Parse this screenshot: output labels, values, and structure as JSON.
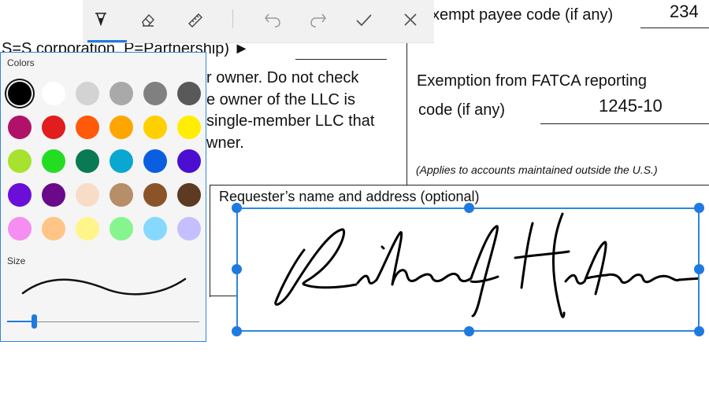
{
  "toolbar": {
    "tools": [
      {
        "id": "pen",
        "icon": "pen-icon",
        "active": true
      },
      {
        "id": "eraser",
        "icon": "eraser-icon"
      },
      {
        "id": "ruler",
        "icon": "ruler-icon"
      },
      {
        "id": "undo",
        "icon": "undo-icon"
      },
      {
        "id": "redo",
        "icon": "redo-icon"
      },
      {
        "id": "done",
        "icon": "checkmark-icon"
      },
      {
        "id": "close",
        "icon": "close-icon"
      }
    ],
    "accent": "#1f7ae0"
  },
  "palette": {
    "colors_label": "Colors",
    "size_label": "Size",
    "size_value": 0.14,
    "selected_color": "#000000",
    "swatches": [
      "#000000",
      "#ffffff",
      "#d3d3d3",
      "#a9a9a9",
      "#808080",
      "#595959",
      "#b0126a",
      "#e11d1d",
      "#ff5a0a",
      "#ffa500",
      "#ffd000",
      "#ffee00",
      "#a6e22e",
      "#22dd22",
      "#0a7a55",
      "#0aa8d0",
      "#0a5ee0",
      "#4a0fd0",
      "#6a0ed8",
      "#6a0a8a",
      "#f7dcc8",
      "#b68e68",
      "#8a5428",
      "#5e3a22",
      "#f58ef0",
      "#ffc486",
      "#fff58a",
      "#86f58e",
      "#86d8ff",
      "#c4c0ff"
    ]
  },
  "document": {
    "exempt_payee_label": "xempt payee code (if any)",
    "exempt_payee_value": "234",
    "classification_line": "S=S corporation, P=Partnership) ►",
    "owner_line1": "r owner.  Do not check",
    "owner_line2": "e owner of the LLC is",
    "owner_line3": "single-member LLC that",
    "owner_line4": "wner.",
    "fatca_label_line1": "Exemption from FATCA reporting",
    "fatca_label_line2": "code (if any)",
    "fatca_value": "1245-10",
    "applies_note": "(Applies to accounts maintained outside the U.S.)",
    "requester_label": "Requester’s name and address (optional)"
  }
}
